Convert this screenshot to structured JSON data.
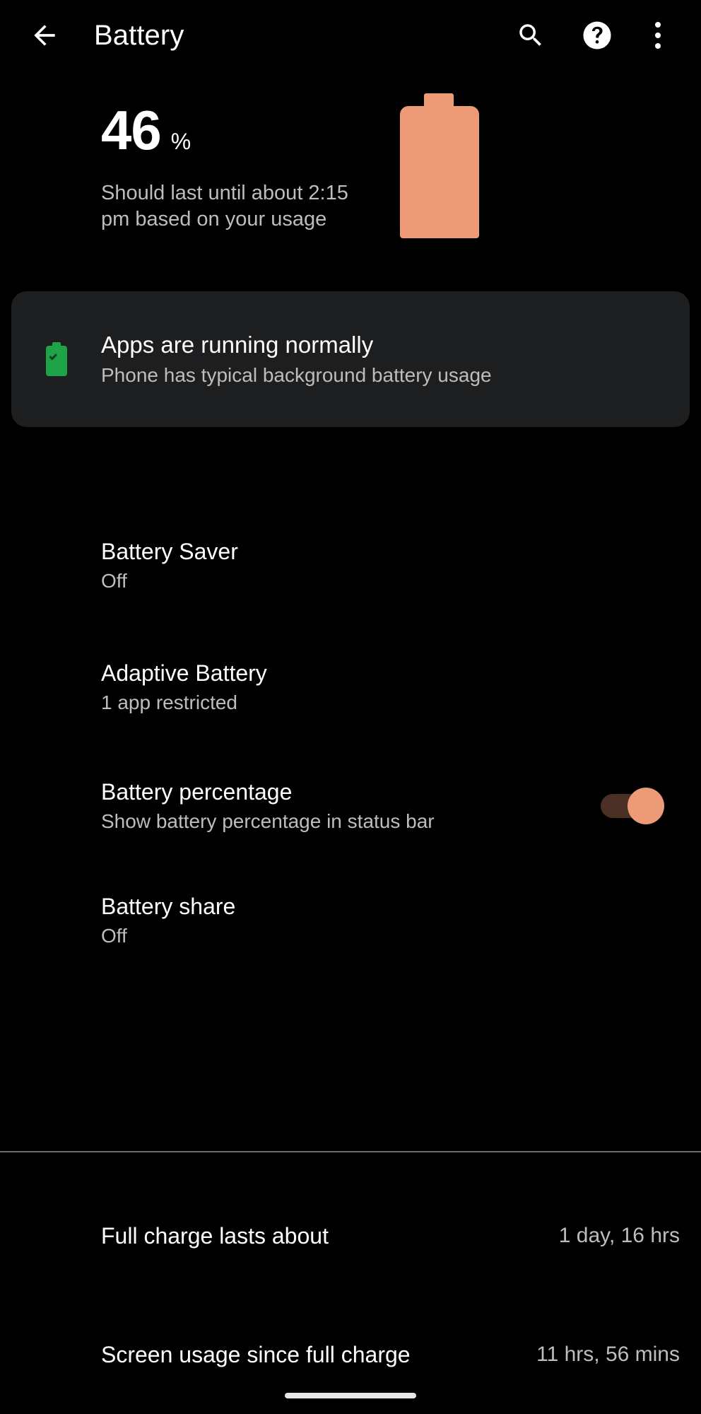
{
  "appbar": {
    "title": "Battery",
    "back_icon": "arrow-left-icon",
    "search_icon": "search-icon",
    "help_icon": "help-circle-icon",
    "more_icon": "overflow-menu-icon"
  },
  "summary": {
    "percent": "46",
    "percent_sign": "%",
    "estimate": "Should last until about 2:15 pm based on your usage",
    "battery_icon": "battery-full-illustration",
    "battery_color": "#ED9A77"
  },
  "tip_card": {
    "icon": "battery-check-icon",
    "icon_color": "#1EA446",
    "background": "#1D1E20",
    "title": "Apps are running normally",
    "description": "Phone has typical background battery usage"
  },
  "preferences": [
    {
      "title": "Battery Saver",
      "summary": "Off",
      "has_toggle": false
    },
    {
      "title": "Adaptive Battery",
      "summary": "1 app restricted",
      "has_toggle": false
    },
    {
      "title": "Battery percentage",
      "summary": "Show battery percentage in status bar",
      "has_toggle": true,
      "toggle_on": true,
      "toggle_track_color": "#4A2F25",
      "toggle_thumb_color": "#ED9A77"
    },
    {
      "title": "Battery share",
      "summary": "Off",
      "has_toggle": false
    }
  ],
  "stats": [
    {
      "label": "Full charge lasts about",
      "value": "1 day, 16 hrs"
    },
    {
      "label": "Screen usage since full charge",
      "value": "11 hrs, 56 mins"
    }
  ],
  "navigation": {
    "gesture_bar": "home-gesture-bar"
  }
}
